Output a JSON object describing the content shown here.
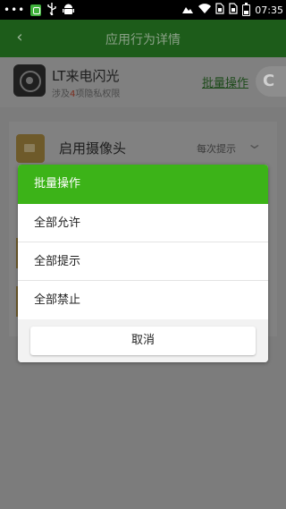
{
  "status_bar": {
    "dots": "•••",
    "time": "07:35",
    "left_icons": [
      "shield-icon",
      "usb-icon",
      "android-icon"
    ],
    "right_icons": [
      "weather-icon",
      "wifi-icon",
      "sim1-icon",
      "sim2-icon",
      "battery-icon"
    ]
  },
  "toolbar": {
    "back_icon": "‹",
    "title": "应用行为详情"
  },
  "app": {
    "name": "LT来电闪光",
    "subtitle_prefix": "涉及",
    "subtitle_count": "4",
    "subtitle_suffix": "项隐私权限",
    "batch_link": "批量操作",
    "float_icon": "C"
  },
  "permission": {
    "label": "启用摄像头",
    "value": "每次提示"
  },
  "dialog": {
    "title": "批量操作",
    "options": [
      "全部允许",
      "全部提示",
      "全部禁止"
    ],
    "cancel_label": "取消"
  },
  "colors": {
    "toolbar_dimmed": "#1d5c1a",
    "dialog_header": "#3cb318",
    "overlay_dim": "#7c7c7c"
  }
}
